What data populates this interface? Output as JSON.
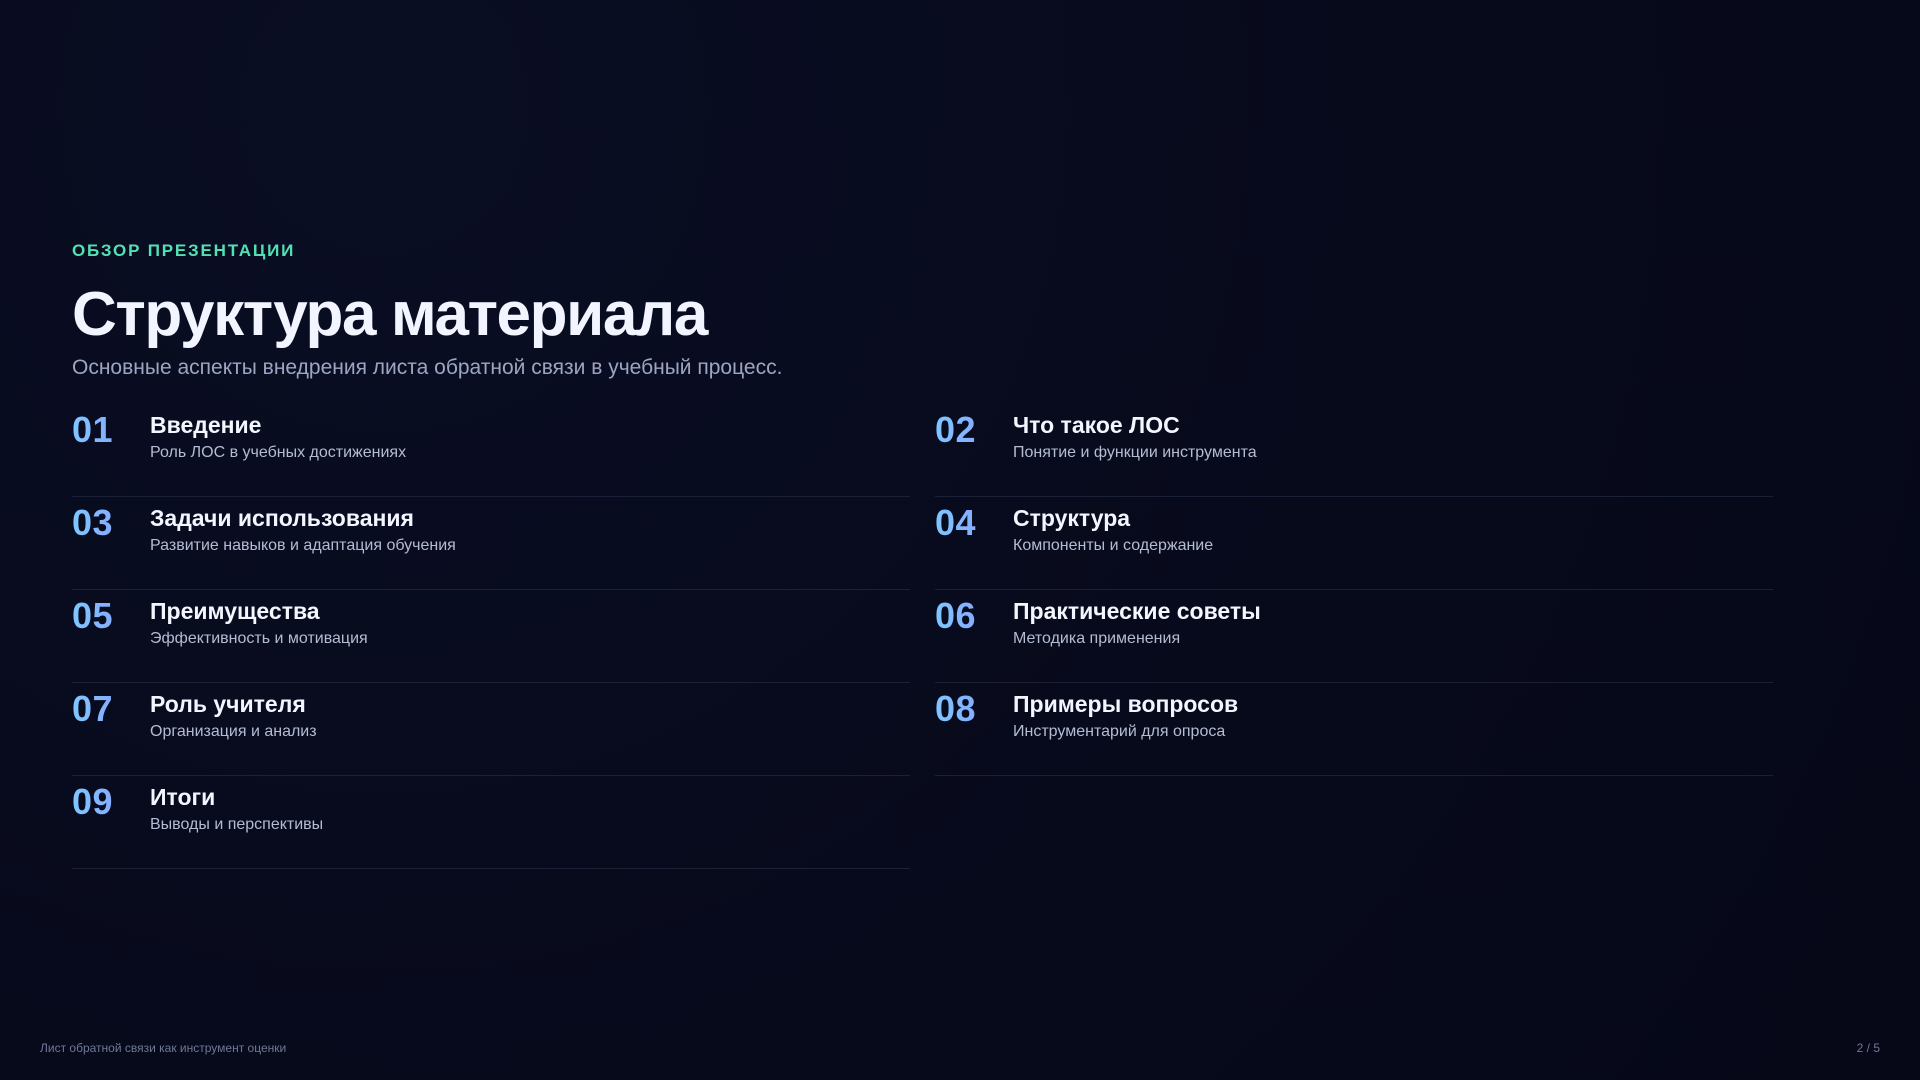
{
  "header": {
    "eyebrow": "ОБЗОР ПРЕЗЕНТАЦИИ",
    "title": "Структура материала",
    "subtitle": "Основные аспекты внедрения листа обратной связи в учебный процесс."
  },
  "agenda": {
    "items": [
      {
        "number": "01",
        "title": "Введение",
        "description": "Роль ЛОС в учебных достижениях"
      },
      {
        "number": "02",
        "title": "Что такое ЛОС",
        "description": "Понятие и функции инструмента"
      },
      {
        "number": "03",
        "title": "Задачи использования",
        "description": "Развитие навыков и адаптация обучения"
      },
      {
        "number": "04",
        "title": "Структура",
        "description": "Компоненты и содержание"
      },
      {
        "number": "05",
        "title": "Преимущества",
        "description": "Эффективность и мотивация"
      },
      {
        "number": "06",
        "title": "Практические советы",
        "description": "Методика применения"
      },
      {
        "number": "07",
        "title": "Роль учителя",
        "description": "Организация и анализ"
      },
      {
        "number": "08",
        "title": "Примеры вопросов",
        "description": "Инструментарий для опроса"
      },
      {
        "number": "09",
        "title": "Итоги",
        "description": "Выводы и перспективы"
      }
    ]
  },
  "footer": {
    "left_text": "Лист обратной связи как инструмент оценки",
    "page_indicator": "2 / 5"
  },
  "colors": {
    "background": "#070a1b",
    "accent_green": "#53e0b4",
    "number_gradient_start": "#7ec7ff",
    "number_gradient_end": "#8d95ff",
    "title_text": "#f2f5ff",
    "secondary_text": "#9ca6c2"
  }
}
